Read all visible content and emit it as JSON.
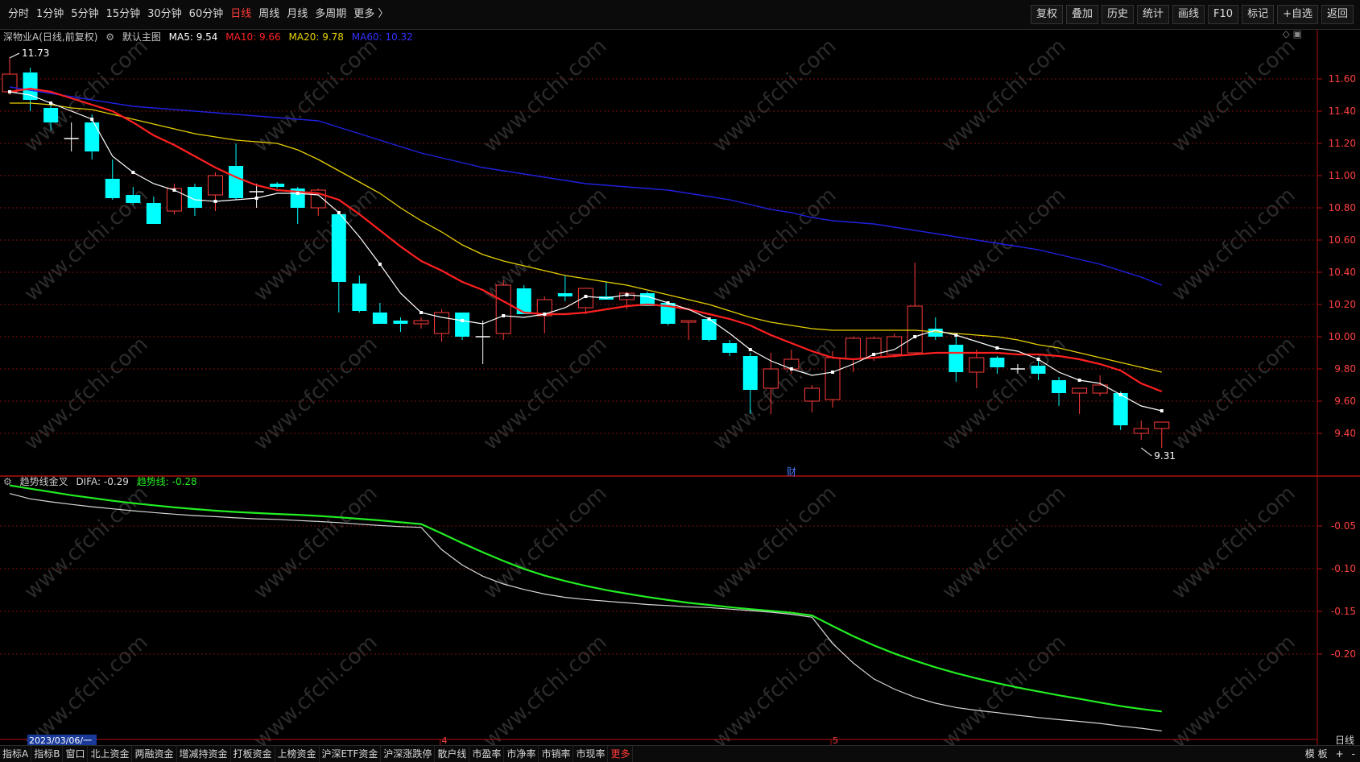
{
  "toolbar": {
    "periods": [
      "分时",
      "1分钟",
      "5分钟",
      "15分钟",
      "30分钟",
      "60分钟",
      "日线",
      "周线",
      "月线",
      "多周期",
      "更多 〉"
    ],
    "active_period": "日线",
    "right_tools": [
      "复权",
      "叠加",
      "历史",
      "统计",
      "画线",
      "F10",
      "标记",
      "+自选",
      "返回"
    ]
  },
  "main_legend": {
    "title": "深物业A(日线,前复权)",
    "template": "默认主图",
    "ma5": "MA5: 9.54",
    "ma10": "MA10: 9.66",
    "ma20": "MA20: 9.78",
    "ma60": "MA60: 10.32"
  },
  "indicator_legend": {
    "title": "趋势线金叉",
    "difa": "DIFA: -0.29",
    "trend": "趋势线: -0.28"
  },
  "colors": {
    "up": "#ff3b3b",
    "down": "#00ffff",
    "ma5": "#ffffff",
    "ma10": "#ff2020",
    "ma20": "#e6d000",
    "ma60": "#2020e0",
    "difa": "#d8d8d8",
    "trend": "#22ee22",
    "grid": "#7a1010",
    "axis_text": "#ff4040"
  },
  "watermark": "www.cfchi.com",
  "chart_data": [
    {
      "type": "candlestick",
      "title": "深物业A(日线,前复权)",
      "x_labels": [
        {
          "index": 21,
          "label": "4"
        },
        {
          "index": 40,
          "label": "5"
        }
      ],
      "date_label": "2023/03/06/一",
      "y_ticks": [
        11.6,
        11.4,
        11.2,
        11.0,
        10.8,
        10.6,
        10.4,
        10.2,
        10.0,
        9.8,
        9.6,
        9.4
      ],
      "ylim": [
        9.18,
        11.85
      ],
      "grid": true,
      "annotations": [
        {
          "text": "11.73",
          "index": 0,
          "value": 11.73
        },
        {
          "text": "9.31",
          "index": 55,
          "value": 9.31
        },
        {
          "text": "财",
          "index": 38
        }
      ],
      "ohlc": [
        [
          11.52,
          11.73,
          11.5,
          11.63
        ],
        [
          11.64,
          11.67,
          11.4,
          11.47
        ],
        [
          11.42,
          11.45,
          11.28,
          11.33
        ],
        [
          11.23,
          11.33,
          11.15,
          11.23
        ],
        [
          11.33,
          11.38,
          11.1,
          11.15
        ],
        [
          10.98,
          11.1,
          10.85,
          10.86
        ],
        [
          10.88,
          10.93,
          10.82,
          10.83
        ],
        [
          10.83,
          10.87,
          10.7,
          10.7
        ],
        [
          10.78,
          10.95,
          10.76,
          10.92
        ],
        [
          10.93,
          10.95,
          10.75,
          10.8
        ],
        [
          10.88,
          11.02,
          10.78,
          11.0
        ],
        [
          11.06,
          11.2,
          10.85,
          10.86
        ],
        [
          10.9,
          10.95,
          10.8,
          10.9
        ],
        [
          10.95,
          10.96,
          10.92,
          10.93
        ],
        [
          10.92,
          10.93,
          10.7,
          10.8
        ],
        [
          10.8,
          10.92,
          10.75,
          10.91
        ],
        [
          10.76,
          10.77,
          10.15,
          10.34
        ],
        [
          10.33,
          10.38,
          10.15,
          10.16
        ],
        [
          10.15,
          10.21,
          10.08,
          10.08
        ],
        [
          10.1,
          10.12,
          10.03,
          10.08
        ],
        [
          10.08,
          10.12,
          10.05,
          10.1
        ],
        [
          10.02,
          10.17,
          9.97,
          10.15
        ],
        [
          10.15,
          10.15,
          9.98,
          10.0
        ],
        [
          10.0,
          10.1,
          9.83,
          10.0
        ],
        [
          10.02,
          10.35,
          9.98,
          10.32
        ],
        [
          10.3,
          10.32,
          10.14,
          10.14
        ],
        [
          10.13,
          10.25,
          10.02,
          10.23
        ],
        [
          10.27,
          10.38,
          10.22,
          10.25
        ],
        [
          10.18,
          10.3,
          10.14,
          10.3
        ],
        [
          10.25,
          10.34,
          10.23,
          10.23
        ],
        [
          10.23,
          10.28,
          10.17,
          10.27
        ],
        [
          10.27,
          10.28,
          10.19,
          10.19
        ],
        [
          10.21,
          10.22,
          10.07,
          10.08
        ],
        [
          10.09,
          10.1,
          9.98,
          10.1
        ],
        [
          10.11,
          10.11,
          9.97,
          9.98
        ],
        [
          9.96,
          9.98,
          9.88,
          9.9
        ],
        [
          9.88,
          9.9,
          9.52,
          9.67
        ],
        [
          9.68,
          9.9,
          9.52,
          9.8
        ],
        [
          9.8,
          9.92,
          9.77,
          9.86
        ],
        [
          9.6,
          9.7,
          9.53,
          9.68
        ],
        [
          9.61,
          9.91,
          9.56,
          9.87
        ],
        [
          9.86,
          10.0,
          9.78,
          9.99
        ],
        [
          9.87,
          10.0,
          9.85,
          9.99
        ],
        [
          9.89,
          10.02,
          9.87,
          10.0
        ],
        [
          9.9,
          10.46,
          9.89,
          10.19
        ],
        [
          10.05,
          10.12,
          9.98,
          10.0
        ],
        [
          9.95,
          10.02,
          9.72,
          9.78
        ],
        [
          9.78,
          9.92,
          9.68,
          9.87
        ],
        [
          9.87,
          9.88,
          9.77,
          9.81
        ],
        [
          9.8,
          9.83,
          9.77,
          9.8
        ],
        [
          9.82,
          9.85,
          9.73,
          9.77
        ],
        [
          9.73,
          9.75,
          9.57,
          9.65
        ],
        [
          9.65,
          9.68,
          9.52,
          9.68
        ],
        [
          9.65,
          9.76,
          9.63,
          9.7
        ],
        [
          9.65,
          9.66,
          9.42,
          9.45
        ],
        [
          9.4,
          9.48,
          9.36,
          9.43
        ],
        [
          9.43,
          9.47,
          9.31,
          9.47
        ]
      ],
      "ma5": [
        11.52,
        11.5,
        11.45,
        11.4,
        11.35,
        11.12,
        11.02,
        10.95,
        10.91,
        10.85,
        10.84,
        10.85,
        10.86,
        10.89,
        10.89,
        10.88,
        10.77,
        10.62,
        10.45,
        10.27,
        10.15,
        10.12,
        10.1,
        10.08,
        10.13,
        10.12,
        10.14,
        10.18,
        10.25,
        10.24,
        10.26,
        10.25,
        10.21,
        10.17,
        10.11,
        10.02,
        9.92,
        9.85,
        9.8,
        9.76,
        9.78,
        9.83,
        9.89,
        9.92,
        10.0,
        10.04,
        10.01,
        9.97,
        9.93,
        9.91,
        9.86,
        9.78,
        9.73,
        9.71,
        9.64,
        9.57,
        9.54
      ],
      "ma10": [
        11.52,
        11.54,
        11.52,
        11.48,
        11.44,
        11.4,
        11.33,
        11.25,
        11.19,
        11.12,
        11.05,
        10.99,
        10.94,
        10.91,
        10.9,
        10.89,
        10.85,
        10.76,
        10.66,
        10.56,
        10.47,
        10.41,
        10.34,
        10.29,
        10.22,
        10.15,
        10.14,
        10.14,
        10.15,
        10.17,
        10.19,
        10.2,
        10.19,
        10.17,
        10.14,
        10.11,
        10.07,
        10.01,
        9.96,
        9.91,
        9.87,
        9.86,
        9.87,
        9.88,
        9.89,
        9.9,
        9.9,
        9.9,
        9.9,
        9.89,
        9.89,
        9.88,
        9.86,
        9.83,
        9.79,
        9.71,
        9.66
      ],
      "ma20": [
        11.45,
        11.45,
        11.44,
        11.42,
        11.41,
        11.38,
        11.35,
        11.32,
        11.29,
        11.26,
        11.24,
        11.22,
        11.21,
        11.2,
        11.16,
        11.1,
        11.03,
        10.96,
        10.89,
        10.8,
        10.72,
        10.65,
        10.57,
        10.51,
        10.47,
        10.44,
        10.41,
        10.38,
        10.36,
        10.34,
        10.32,
        10.29,
        10.26,
        10.23,
        10.2,
        10.16,
        10.12,
        10.09,
        10.07,
        10.05,
        10.04,
        10.04,
        10.04,
        10.04,
        10.04,
        10.03,
        10.02,
        10.01,
        10.0,
        9.98,
        9.95,
        9.93,
        9.9,
        9.87,
        9.84,
        9.81,
        9.78
      ],
      "ma60": [
        11.55,
        11.53,
        11.51,
        11.49,
        11.47,
        11.45,
        11.43,
        11.42,
        11.41,
        11.4,
        11.39,
        11.38,
        11.37,
        11.36,
        11.35,
        11.34,
        11.3,
        11.26,
        11.22,
        11.18,
        11.14,
        11.11,
        11.08,
        11.05,
        11.03,
        11.01,
        10.99,
        10.97,
        10.95,
        10.94,
        10.93,
        10.92,
        10.91,
        10.89,
        10.87,
        10.85,
        10.82,
        10.79,
        10.77,
        10.74,
        10.72,
        10.71,
        10.7,
        10.68,
        10.66,
        10.64,
        10.62,
        10.6,
        10.58,
        10.56,
        10.54,
        10.51,
        10.48,
        10.45,
        10.41,
        10.37,
        10.32
      ]
    },
    {
      "type": "line",
      "title": "趋势线金叉",
      "y_ticks": [
        -0.05,
        -0.1,
        -0.15,
        -0.2
      ],
      "ylim": [
        -0.3,
        0.0
      ],
      "grid": true,
      "series": [
        {
          "name": "DIFA",
          "values": [
            -0.012,
            -0.0182,
            -0.0217,
            -0.0247,
            -0.0275,
            -0.0299,
            -0.0322,
            -0.0342,
            -0.0361,
            -0.0378,
            -0.0391,
            -0.0405,
            -0.0416,
            -0.0423,
            -0.0436,
            -0.0447,
            -0.046,
            -0.0478,
            -0.0494,
            -0.0508,
            -0.0516,
            -0.0777,
            -0.0958,
            -0.1088,
            -0.1179,
            -0.1243,
            -0.1297,
            -0.1336,
            -0.1361,
            -0.1381,
            -0.14,
            -0.142,
            -0.1432,
            -0.1446,
            -0.1456,
            -0.1474,
            -0.1491,
            -0.1509,
            -0.1534,
            -0.1569,
            -0.1875,
            -0.2104,
            -0.2291,
            -0.241,
            -0.2506,
            -0.2575,
            -0.2625,
            -0.2659,
            -0.2686,
            -0.2717,
            -0.2743,
            -0.2768,
            -0.2789,
            -0.2812,
            -0.2843,
            -0.2869,
            -0.2899
          ]
        },
        {
          "name": "趋势线",
          "values": [
            -0.0025,
            -0.0063,
            -0.0101,
            -0.014,
            -0.0172,
            -0.0205,
            -0.0233,
            -0.0258,
            -0.0282,
            -0.0302,
            -0.0321,
            -0.0336,
            -0.0348,
            -0.0359,
            -0.0369,
            -0.0382,
            -0.0398,
            -0.0416,
            -0.0434,
            -0.0457,
            -0.0477,
            -0.0587,
            -0.07,
            -0.0808,
            -0.0909,
            -0.1003,
            -0.1081,
            -0.1144,
            -0.1201,
            -0.1251,
            -0.1292,
            -0.1332,
            -0.1367,
            -0.14,
            -0.1425,
            -0.1451,
            -0.1474,
            -0.1494,
            -0.1516,
            -0.1548,
            -0.1671,
            -0.179,
            -0.1897,
            -0.1993,
            -0.2077,
            -0.2155,
            -0.2224,
            -0.2285,
            -0.2341,
            -0.2392,
            -0.2438,
            -0.2483,
            -0.2525,
            -0.2568,
            -0.2609,
            -0.2643,
            -0.2673
          ]
        }
      ]
    }
  ],
  "bottom": {
    "tabs": [
      "指标A",
      "指标B",
      "窗口",
      "北上资金",
      "两融资金",
      "增减持资金",
      "打板资金",
      "上榜资金",
      "沪深ETF资金",
      "沪深涨跌停",
      "散户线",
      "市盈率",
      "市净率",
      "市销率",
      "市现率",
      "更多"
    ],
    "right": [
      "模 板",
      "+",
      "-"
    ],
    "period_label": "日线"
  }
}
